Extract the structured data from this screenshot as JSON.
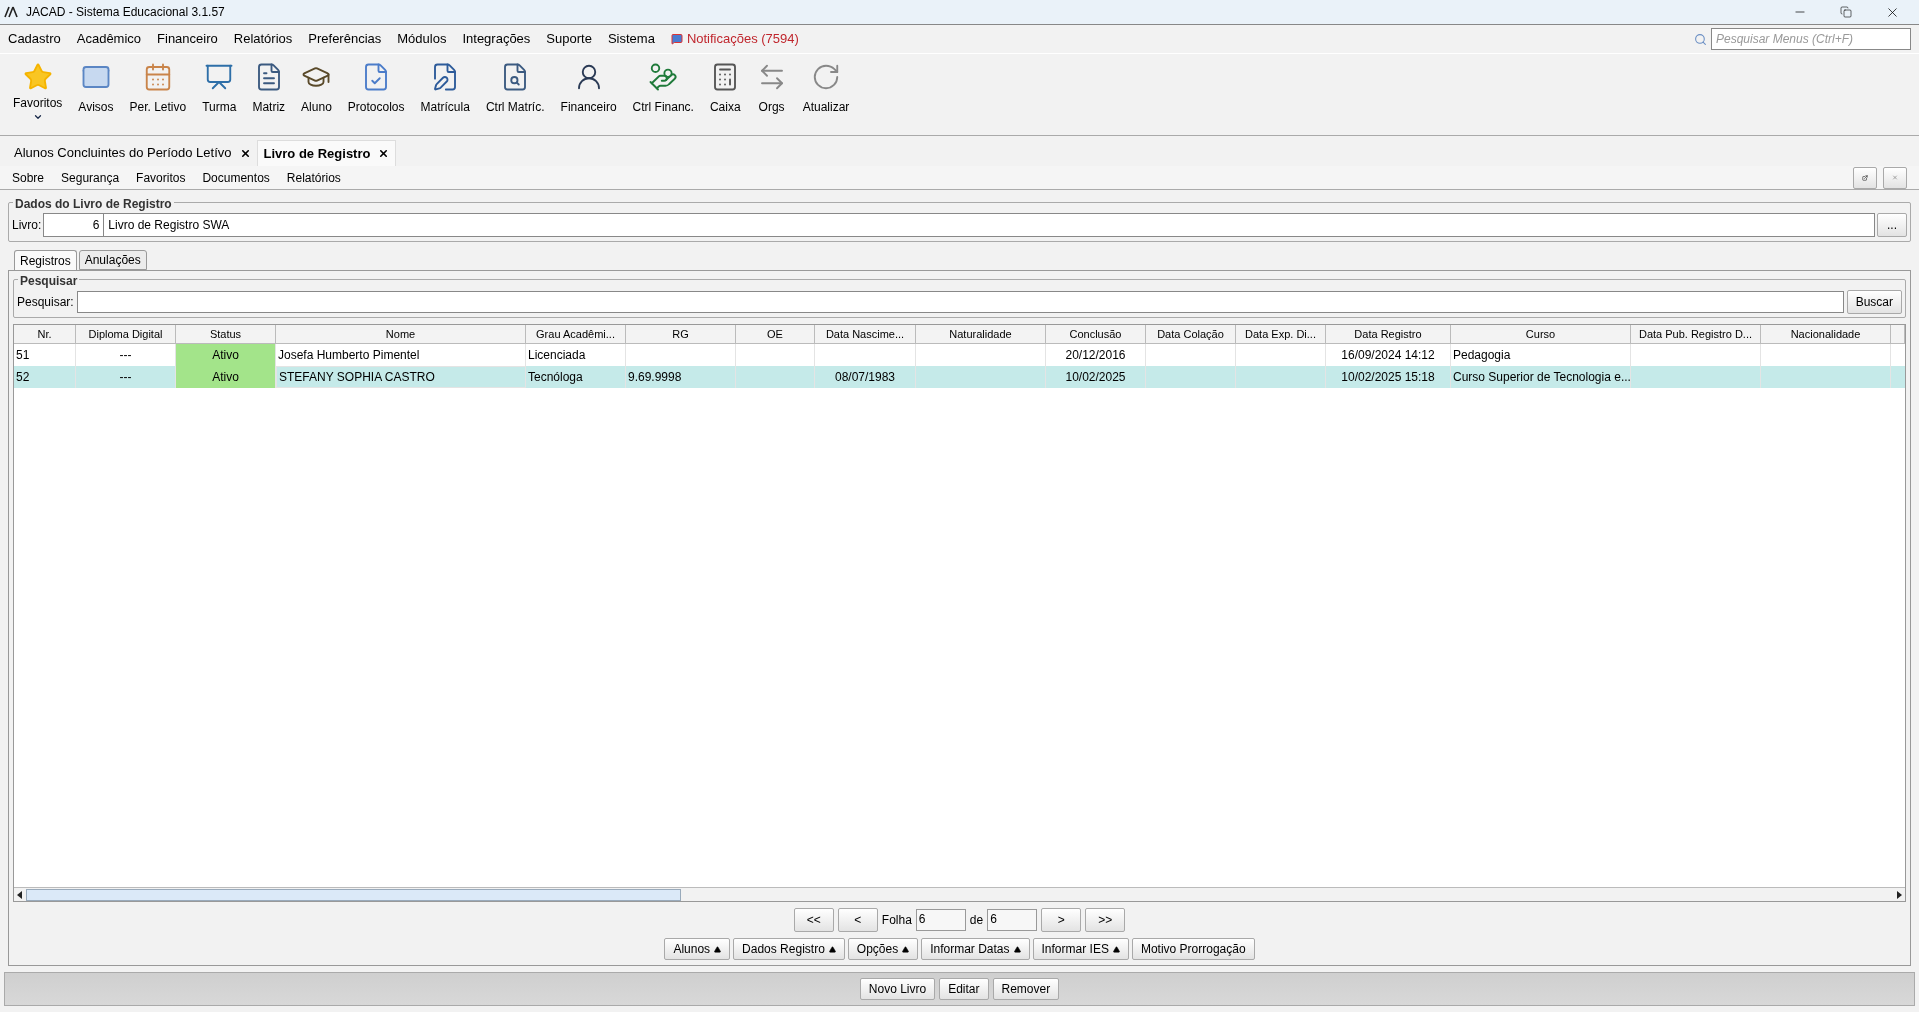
{
  "window": {
    "title": "JACAD - Sistema Educacional 3.1.57"
  },
  "menu": [
    "Cadastro",
    "Acadêmico",
    "Financeiro",
    "Relatórios",
    "Preferências",
    "Módulos",
    "Integrações",
    "Suporte",
    "Sistema"
  ],
  "notifications": "Notificações (7594)",
  "menu_search": {
    "placeholder": "Pesquisar Menus (Ctrl+F)"
  },
  "toolbar": [
    {
      "kind": "star",
      "label": "Favoritos"
    },
    {
      "kind": "mail",
      "label": "Avisos"
    },
    {
      "kind": "calendar",
      "label": "Per. Letivo"
    },
    {
      "kind": "class",
      "label": "Turma"
    },
    {
      "kind": "doc",
      "label": "Matriz"
    },
    {
      "kind": "student",
      "label": "Aluno"
    },
    {
      "kind": "protocol",
      "label": "Protocolos"
    },
    {
      "kind": "edit",
      "label": "Matrícula"
    },
    {
      "kind": "inspect",
      "label": "Ctrl Matríc."
    },
    {
      "kind": "finance",
      "label": "Financeiro"
    },
    {
      "kind": "money",
      "label": "Ctrl Financ."
    },
    {
      "kind": "register",
      "label": "Caixa"
    },
    {
      "kind": "swap",
      "label": "Orgs"
    },
    {
      "kind": "refresh",
      "label": "Atualizar"
    }
  ],
  "doc_tabs": [
    {
      "label": "Alunos Concluintes do Período Letívo",
      "selected": false
    },
    {
      "label": "Livro de Registro",
      "selected": true
    }
  ],
  "submenu": [
    "Sobre",
    "Segurança",
    "Favoritos",
    "Documentos",
    "Relatórios"
  ],
  "book_group": {
    "title": "Dados do Livro de Registro",
    "label": "Livro:",
    "number": "6",
    "name": "Livro de Registro SWA",
    "browse": "..."
  },
  "tabs": [
    {
      "label": "Registros",
      "selected": true
    },
    {
      "label": "Anulações",
      "selected": false
    }
  ],
  "search_group": {
    "title": "Pesquisar",
    "label": "Pesquisar:",
    "button": "Buscar"
  },
  "table": {
    "columns": [
      "Nr.",
      "Diploma Digital",
      "Status",
      "Nome",
      "Grau Acadêmi...",
      "RG",
      "OE",
      "Data Nascime...",
      "Naturalidade",
      "Conclusão",
      "Data Colação",
      "Data Exp. Di...",
      "Data Registro",
      "Curso",
      "Data Pub. Registro D...",
      "Nacionalidade"
    ],
    "rows": [
      {
        "selected": false,
        "cells": [
          "51",
          "---",
          "Ativo",
          "Josefa Humberto Pimentel",
          "Licenciada",
          "",
          "",
          "",
          "",
          "20/12/2016",
          "",
          "",
          "16/09/2024 14:12",
          "Pedagogia",
          "",
          ""
        ]
      },
      {
        "selected": true,
        "cells": [
          "52",
          "---",
          "Ativo",
          "STEFANY SOPHIA CASTRO",
          "Tecnóloga",
          "9.69.9998",
          "",
          "08/07/1983",
          "",
          "10/02/2025",
          "",
          "",
          "10/02/2025 15:18",
          "Curso Superior de Tecnologia e...",
          "",
          ""
        ]
      }
    ]
  },
  "pager": {
    "first": "<<",
    "prev": "<",
    "label": "Folha",
    "page": "6",
    "of": "de",
    "total": "6",
    "next": ">",
    "last": ">>"
  },
  "actions": [
    {
      "label": "Alunos",
      "menu": true
    },
    {
      "label": "Dados Registro",
      "menu": true
    },
    {
      "label": "Opções",
      "menu": true
    },
    {
      "label": "Informar Datas",
      "menu": true
    },
    {
      "label": "Informar IES",
      "menu": true
    },
    {
      "label": "Motivo Prorrogação",
      "menu": false
    }
  ],
  "bottom_buttons": [
    "Novo Livro",
    "Editar",
    "Remover"
  ]
}
